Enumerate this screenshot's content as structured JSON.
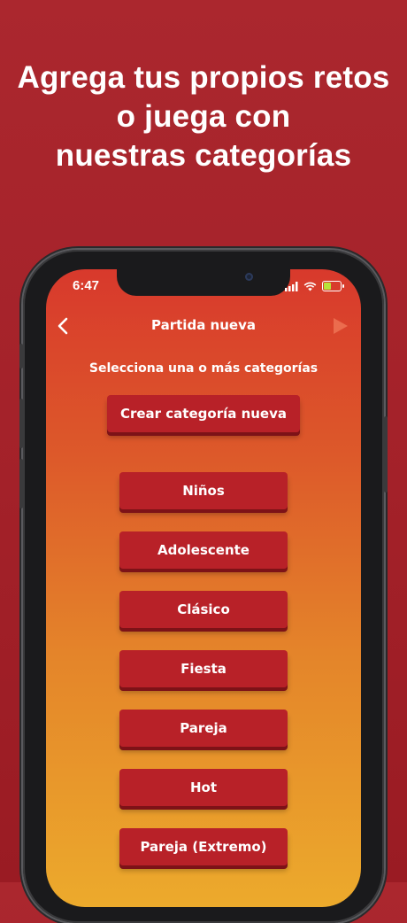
{
  "headline": {
    "line1": "Agrega tus propios retos",
    "line2": "o juega con",
    "line3": "nuestras categorías"
  },
  "status_bar": {
    "time": "6:47",
    "battery_color": "#b7e23a"
  },
  "nav": {
    "title": "Partida nueva",
    "back_icon": "chevron-left-icon",
    "play_icon": "play-icon"
  },
  "subtitle": "Selecciona una o más categorías",
  "create_button": "Crear categoría nueva",
  "categories": [
    "Niños",
    "Adolescente",
    "Clásico",
    "Fiesta",
    "Pareja",
    "Hot",
    "Pareja (Extremo)"
  ],
  "colors": {
    "background": "#a32129",
    "button": "#b82128",
    "button_shadow": "#7d1217",
    "screen_top": "#d8392c",
    "screen_bottom": "#ecaa2c"
  }
}
